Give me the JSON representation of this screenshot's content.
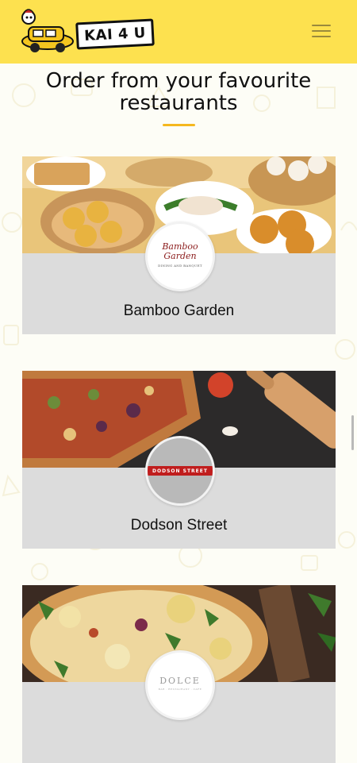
{
  "header": {
    "logo_text": "KAI 4 U",
    "menu_icon": "hamburger-menu-icon"
  },
  "page": {
    "title": "Order from your favourite restaurants"
  },
  "restaurants": [
    {
      "name": "Bamboo Garden",
      "logo_text": "Bamboo Garden",
      "logo_subtext": "DINING AND BANQUET"
    },
    {
      "name": "Dodson Street",
      "logo_text": "DODSON STREET"
    },
    {
      "name": "",
      "logo_text": "DOLCE",
      "logo_subtext": "BAR · RESTAURANT · CAFE"
    }
  ],
  "colors": {
    "header_bg": "#fde14f",
    "accent": "#f5b81f",
    "card_body": "#dcdcdc",
    "dodson_red": "#c01d1d"
  }
}
